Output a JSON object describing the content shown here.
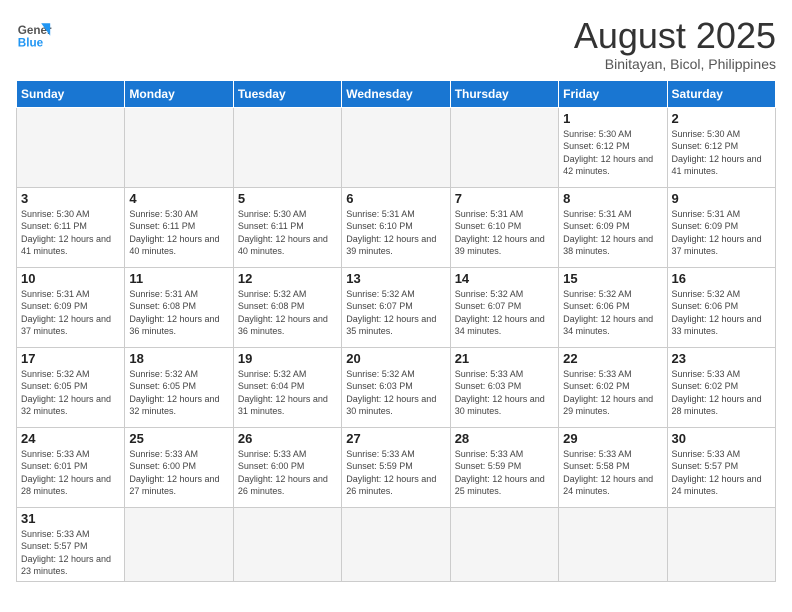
{
  "logo": {
    "general": "General",
    "blue": "Blue"
  },
  "header": {
    "title": "August 2025",
    "subtitle": "Binitayan, Bicol, Philippines"
  },
  "days_of_week": [
    "Sunday",
    "Monday",
    "Tuesday",
    "Wednesday",
    "Thursday",
    "Friday",
    "Saturday"
  ],
  "weeks": [
    [
      {
        "day": "",
        "info": "",
        "empty": true
      },
      {
        "day": "",
        "info": "",
        "empty": true
      },
      {
        "day": "",
        "info": "",
        "empty": true
      },
      {
        "day": "",
        "info": "",
        "empty": true
      },
      {
        "day": "",
        "info": "",
        "empty": true
      },
      {
        "day": "1",
        "info": "Sunrise: 5:30 AM\nSunset: 6:12 PM\nDaylight: 12 hours and 42 minutes."
      },
      {
        "day": "2",
        "info": "Sunrise: 5:30 AM\nSunset: 6:12 PM\nDaylight: 12 hours and 41 minutes."
      }
    ],
    [
      {
        "day": "3",
        "info": "Sunrise: 5:30 AM\nSunset: 6:11 PM\nDaylight: 12 hours and 41 minutes."
      },
      {
        "day": "4",
        "info": "Sunrise: 5:30 AM\nSunset: 6:11 PM\nDaylight: 12 hours and 40 minutes."
      },
      {
        "day": "5",
        "info": "Sunrise: 5:30 AM\nSunset: 6:11 PM\nDaylight: 12 hours and 40 minutes."
      },
      {
        "day": "6",
        "info": "Sunrise: 5:31 AM\nSunset: 6:10 PM\nDaylight: 12 hours and 39 minutes."
      },
      {
        "day": "7",
        "info": "Sunrise: 5:31 AM\nSunset: 6:10 PM\nDaylight: 12 hours and 39 minutes."
      },
      {
        "day": "8",
        "info": "Sunrise: 5:31 AM\nSunset: 6:09 PM\nDaylight: 12 hours and 38 minutes."
      },
      {
        "day": "9",
        "info": "Sunrise: 5:31 AM\nSunset: 6:09 PM\nDaylight: 12 hours and 37 minutes."
      }
    ],
    [
      {
        "day": "10",
        "info": "Sunrise: 5:31 AM\nSunset: 6:09 PM\nDaylight: 12 hours and 37 minutes."
      },
      {
        "day": "11",
        "info": "Sunrise: 5:31 AM\nSunset: 6:08 PM\nDaylight: 12 hours and 36 minutes."
      },
      {
        "day": "12",
        "info": "Sunrise: 5:32 AM\nSunset: 6:08 PM\nDaylight: 12 hours and 36 minutes."
      },
      {
        "day": "13",
        "info": "Sunrise: 5:32 AM\nSunset: 6:07 PM\nDaylight: 12 hours and 35 minutes."
      },
      {
        "day": "14",
        "info": "Sunrise: 5:32 AM\nSunset: 6:07 PM\nDaylight: 12 hours and 34 minutes."
      },
      {
        "day": "15",
        "info": "Sunrise: 5:32 AM\nSunset: 6:06 PM\nDaylight: 12 hours and 34 minutes."
      },
      {
        "day": "16",
        "info": "Sunrise: 5:32 AM\nSunset: 6:06 PM\nDaylight: 12 hours and 33 minutes."
      }
    ],
    [
      {
        "day": "17",
        "info": "Sunrise: 5:32 AM\nSunset: 6:05 PM\nDaylight: 12 hours and 32 minutes."
      },
      {
        "day": "18",
        "info": "Sunrise: 5:32 AM\nSunset: 6:05 PM\nDaylight: 12 hours and 32 minutes."
      },
      {
        "day": "19",
        "info": "Sunrise: 5:32 AM\nSunset: 6:04 PM\nDaylight: 12 hours and 31 minutes."
      },
      {
        "day": "20",
        "info": "Sunrise: 5:32 AM\nSunset: 6:03 PM\nDaylight: 12 hours and 30 minutes."
      },
      {
        "day": "21",
        "info": "Sunrise: 5:33 AM\nSunset: 6:03 PM\nDaylight: 12 hours and 30 minutes."
      },
      {
        "day": "22",
        "info": "Sunrise: 5:33 AM\nSunset: 6:02 PM\nDaylight: 12 hours and 29 minutes."
      },
      {
        "day": "23",
        "info": "Sunrise: 5:33 AM\nSunset: 6:02 PM\nDaylight: 12 hours and 28 minutes."
      }
    ],
    [
      {
        "day": "24",
        "info": "Sunrise: 5:33 AM\nSunset: 6:01 PM\nDaylight: 12 hours and 28 minutes."
      },
      {
        "day": "25",
        "info": "Sunrise: 5:33 AM\nSunset: 6:00 PM\nDaylight: 12 hours and 27 minutes."
      },
      {
        "day": "26",
        "info": "Sunrise: 5:33 AM\nSunset: 6:00 PM\nDaylight: 12 hours and 26 minutes."
      },
      {
        "day": "27",
        "info": "Sunrise: 5:33 AM\nSunset: 5:59 PM\nDaylight: 12 hours and 26 minutes."
      },
      {
        "day": "28",
        "info": "Sunrise: 5:33 AM\nSunset: 5:59 PM\nDaylight: 12 hours and 25 minutes."
      },
      {
        "day": "29",
        "info": "Sunrise: 5:33 AM\nSunset: 5:58 PM\nDaylight: 12 hours and 24 minutes."
      },
      {
        "day": "30",
        "info": "Sunrise: 5:33 AM\nSunset: 5:57 PM\nDaylight: 12 hours and 24 minutes."
      }
    ],
    [
      {
        "day": "31",
        "info": "Sunrise: 5:33 AM\nSunset: 5:57 PM\nDaylight: 12 hours and 23 minutes."
      },
      {
        "day": "",
        "info": "",
        "empty": true
      },
      {
        "day": "",
        "info": "",
        "empty": true
      },
      {
        "day": "",
        "info": "",
        "empty": true
      },
      {
        "day": "",
        "info": "",
        "empty": true
      },
      {
        "day": "",
        "info": "",
        "empty": true
      },
      {
        "day": "",
        "info": "",
        "empty": true
      }
    ]
  ]
}
